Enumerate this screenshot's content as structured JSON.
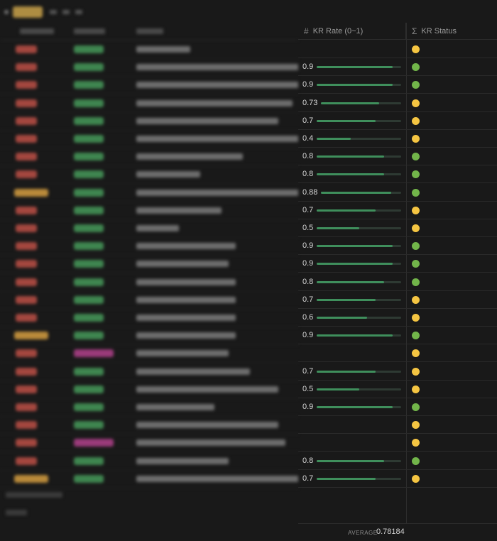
{
  "columns": {
    "rate": {
      "icon": "#",
      "label": "KR Rate (0~1)"
    },
    "status": {
      "icon": "Σ",
      "label": "KR Status"
    }
  },
  "colors": {
    "status_yellow": "#f5c542",
    "status_green": "#72b54a",
    "bar_fill": "#3f8f5c",
    "bar_track": "#2e3a33"
  },
  "rows": [
    {
      "rate": null,
      "status": "yellow"
    },
    {
      "rate": "0.9",
      "status": "green"
    },
    {
      "rate": "0.9",
      "status": "green"
    },
    {
      "rate": "0.73",
      "status": "yellow"
    },
    {
      "rate": "0.7",
      "status": "yellow"
    },
    {
      "rate": "0.4",
      "status": "yellow"
    },
    {
      "rate": "0.8",
      "status": "green"
    },
    {
      "rate": "0.8",
      "status": "green"
    },
    {
      "rate": "0.88",
      "status": "green"
    },
    {
      "rate": "0.7",
      "status": "yellow"
    },
    {
      "rate": "0.5",
      "status": "yellow"
    },
    {
      "rate": "0.9",
      "status": "green"
    },
    {
      "rate": "0.9",
      "status": "green"
    },
    {
      "rate": "0.8",
      "status": "green"
    },
    {
      "rate": "0.7",
      "status": "yellow"
    },
    {
      "rate": "0.6",
      "status": "yellow"
    },
    {
      "rate": "0.9",
      "status": "green"
    },
    {
      "rate": null,
      "status": "yellow"
    },
    {
      "rate": "0.7",
      "status": "yellow"
    },
    {
      "rate": "0.5",
      "status": "yellow"
    },
    {
      "rate": "0.9",
      "status": "green"
    },
    {
      "rate": null,
      "status": "yellow"
    },
    {
      "rate": null,
      "status": "yellow"
    },
    {
      "rate": "0.8",
      "status": "green"
    },
    {
      "rate": "0.7",
      "status": "yellow"
    }
  ],
  "footer": {
    "label": "AVERAGE",
    "value": "0.78184"
  }
}
